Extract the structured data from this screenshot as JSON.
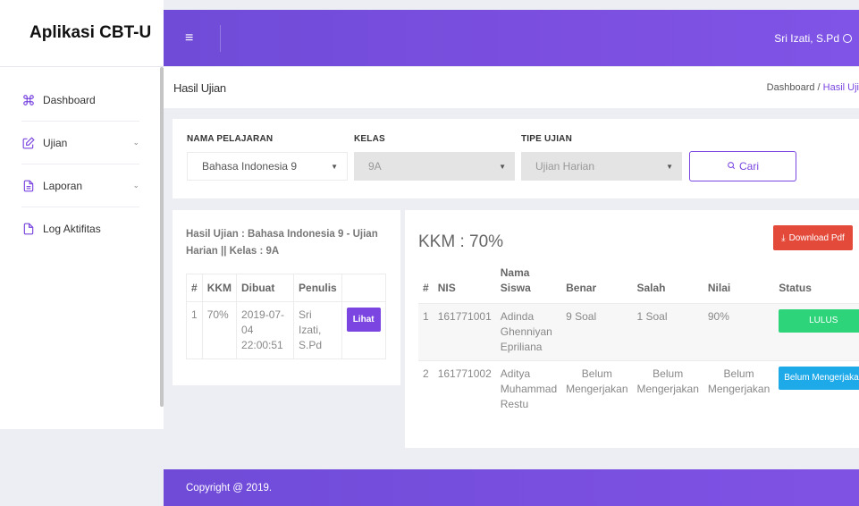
{
  "app": {
    "brand": "Aplikasi CBT-U"
  },
  "sidebar": {
    "items": [
      {
        "label": "Dashboard",
        "icon": "command-icon",
        "expandable": false
      },
      {
        "label": "Ujian",
        "icon": "edit-icon",
        "expandable": true
      },
      {
        "label": "Laporan",
        "icon": "document-icon",
        "expandable": true
      },
      {
        "label": "Log Aktifitas",
        "icon": "file-icon",
        "expandable": false
      }
    ]
  },
  "topbar": {
    "user_name": "Sri Izati, S.Pd"
  },
  "page": {
    "title": "Hasil Ujian",
    "breadcrumb_home": "Dashboard",
    "breadcrumb_sep": " / ",
    "breadcrumb_current": "Hasil Uji"
  },
  "filter": {
    "subject_label": "NAMA PELAJARAN",
    "subject_value": "Bahasa Indonesia 9",
    "class_label": "KELAS",
    "class_value": "9A",
    "type_label": "TIPE UJIAN",
    "type_value": "Ujian Harian",
    "search_label": "Cari"
  },
  "summary": {
    "heading": "Hasil Ujian : Bahasa Indonesia 9 - Ujian Harian || Kelas : 9A",
    "columns": [
      "#",
      "KKM",
      "Dibuat",
      "Penulis",
      ""
    ],
    "rows": [
      {
        "no": "1",
        "kkm": "70%",
        "created": "2019-07-04 22:00:51",
        "author": "Sri Izati, S.Pd",
        "action": "Lihat"
      }
    ]
  },
  "results": {
    "kkm_text": "KKM : 70%",
    "download_label": "Download Pdf",
    "columns": [
      "#",
      "NIS",
      "Nama Siswa",
      "Benar",
      "Salah",
      "Nilai",
      "Status"
    ],
    "rows": [
      {
        "no": "1",
        "nis": "161771001",
        "name": "Adinda Ghenniyan Epriliana",
        "correct": "9 Soal",
        "wrong": "1 Soal",
        "score": "90%",
        "status": "LULUS"
      },
      {
        "no": "2",
        "nis": "161771002",
        "name": "Aditya Muhammad Restu",
        "correct": "Belum Mengerjakan",
        "wrong": "Belum Mengerjakan",
        "score": "Belum Mengerjakan",
        "status": "Belum Mengerjakan"
      }
    ]
  },
  "footer": {
    "copyright": "Copyright @ 2019."
  },
  "colors": {
    "accent": "#7a45e0",
    "danger": "#e34a3a",
    "success": "#2ed47a",
    "info": "#1ea9e8"
  }
}
